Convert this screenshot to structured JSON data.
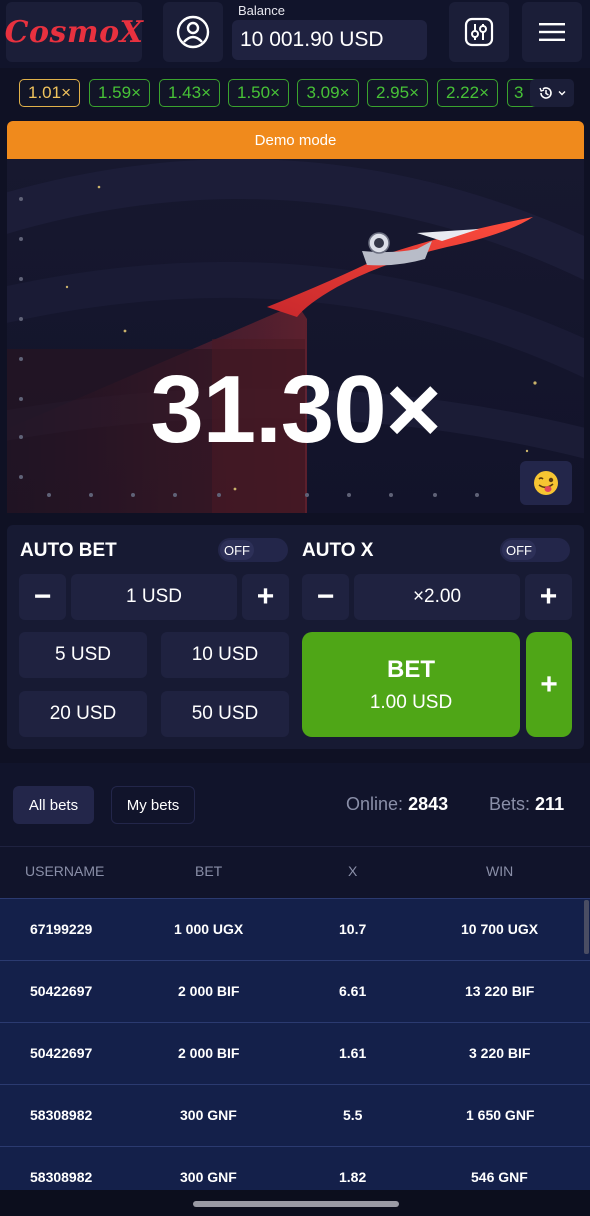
{
  "header": {
    "logo": "CosmoX",
    "balance_label": "Balance",
    "balance_value": "10 001.90 USD",
    "icons": [
      "user-icon",
      "settings-sliders-icon",
      "menu-icon"
    ]
  },
  "history": {
    "chips": [
      "1.01×",
      "1.59×",
      "1.43×",
      "1.50×",
      "3.09×",
      "2.95×",
      "2.22×",
      "3"
    ],
    "icons": [
      "clock-history-icon",
      "chevron-down-icon"
    ]
  },
  "demo_banner": "Demo mode",
  "game": {
    "multiplier": "31.30×",
    "emoji_icon": "winking-tongue-emoji-icon"
  },
  "auto_bet": {
    "title": "AUTO BET",
    "toggle": "OFF",
    "minus": "−",
    "value": "1 USD",
    "plus": "+",
    "quick": [
      "5 USD",
      "10 USD",
      "20 USD",
      "50 USD"
    ]
  },
  "auto_x": {
    "title": "AUTO X",
    "toggle": "OFF",
    "minus": "−",
    "value": "×2.00",
    "plus": "+"
  },
  "bet_button": {
    "label": "BET",
    "amount": "1.00 USD",
    "add": "+"
  },
  "bets": {
    "tabs": [
      "All bets",
      "My bets"
    ],
    "online_label": "Online:",
    "online_value": "2843",
    "bets_label": "Bets:",
    "bets_value": "211",
    "columns": [
      "USERNAME",
      "BET",
      "X",
      "WIN"
    ],
    "rows": [
      [
        "67199229",
        "1 000 UGX",
        "10.7",
        "10 700 UGX"
      ],
      [
        "50422697",
        "2 000 BIF",
        "6.61",
        "13 220 BIF"
      ],
      [
        "50422697",
        "2 000 BIF",
        "1.61",
        "3 220 BIF"
      ],
      [
        "58308982",
        "300 GNF",
        "5.5",
        "1 650 GNF"
      ],
      [
        "58308982",
        "300 GNF",
        "1.82",
        "546 GNF"
      ]
    ]
  },
  "colors": {
    "background": "#0f1124",
    "brand_red": "#e8313f",
    "accent_orange": "#f08a1c",
    "bet_green": "#4fa617",
    "chip_green": "#47c237",
    "chip_gold": "#f0c35d",
    "row_blue": "#14204a"
  }
}
